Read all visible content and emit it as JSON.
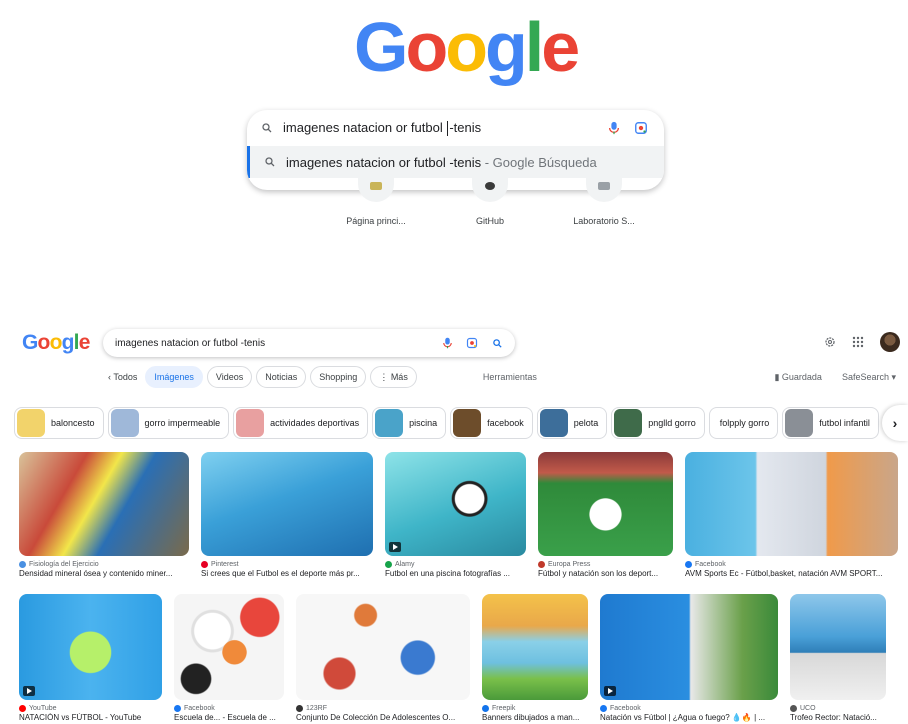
{
  "home": {
    "logo": [
      "G",
      "o",
      "o",
      "g",
      "l",
      "e"
    ],
    "query_before_caret": "imagenes natacion or futbol ",
    "query_after_caret": "-tenis",
    "suggestion_query": "imagenes natacion or futbol -tenis",
    "suggestion_suffix": " - Google Búsqueda",
    "shortcuts": [
      {
        "label": "Página princi..."
      },
      {
        "label": "GitHub"
      },
      {
        "label": "Laboratorio S..."
      }
    ]
  },
  "results": {
    "logo": [
      "G",
      "o",
      "o",
      "g",
      "l",
      "e"
    ],
    "query": "imagenes natacion or futbol -tenis",
    "nav": {
      "back": "‹ Todos",
      "tabs": [
        "Imágenes",
        "Videos",
        "Noticias",
        "Shopping",
        "⋮ Más"
      ],
      "active_tab": "Imágenes",
      "tools": "Herramientas",
      "saved": "Guardada",
      "safesearch": "SafeSearch ▾"
    },
    "filters": [
      {
        "label": "baloncesto",
        "color": "#f2d36b"
      },
      {
        "label": "gorro impermeable",
        "color": "#9fb8d9"
      },
      {
        "label": "actividades deportivas",
        "color": "#e8a0a0"
      },
      {
        "label": "piscina",
        "color": "#4aa3c9"
      },
      {
        "label": "facebook",
        "color": "#6d4d2b"
      },
      {
        "label": "pelota",
        "color": "#3d6e9a"
      },
      {
        "label": "pnglld gorro",
        "color": "#3f6b4a"
      },
      {
        "label": "folpply gorro",
        "color": ""
      },
      {
        "label": "futbol infantil",
        "color": "#8a8f96"
      }
    ],
    "row1": [
      {
        "source": "Fisiología del Ejercicio",
        "title": "Densidad mineral ósea y contenido miner...",
        "dot": "#4a90e2",
        "bg": "linear-gradient(120deg,#d9c39a 0%,#c94a3a 30%,#f2e64a 45%,#2a6fb5 60%,#7a6a4a 100%)"
      },
      {
        "source": "Pinterest",
        "title": "Si crees que el Futbol es el deporte más pr...",
        "dot": "#e60023",
        "bg": "linear-gradient(160deg,#7fd0f0 0%,#3aa0d8 45%,#1f6fb0 100%)"
      },
      {
        "source": "Alamy",
        "title": "Futbol en una piscina fotografías ...",
        "dot": "#17a34a",
        "bg": "radial-gradient(circle at 60% 45%,#ffffff 0 14%,#222 15% 17%,transparent 18%),linear-gradient(160deg,#8ee3e8 0%,#3fb5c8 55%,#2a8aa0 100%)"
      },
      {
        "source": "Europa Press",
        "title": "Fútbol y natación son los deport...",
        "dot": "#c0392b",
        "bg": "radial-gradient(circle at 50% 60%,#ffffff 0 17%,transparent 18%),linear-gradient(180deg,#8a3a3a 0%,#c25a4a 20%,#2f8a3a 30%,#3aa04a 100%)"
      },
      {
        "source": "Facebook",
        "title": "AVM Sports Ec - Fútbol,basket, natación AVM SPORT...",
        "dot": "#1877f2",
        "bg": "linear-gradient(90deg,#4ab0e0 0%,#6cc5ea 33%,#e4e8ef 34%,#cfd5de 66%,#f09a4a 67%,#c9a68a 100%)"
      }
    ],
    "row2": [
      {
        "source": "YouTube",
        "title": "NATACIÓN vs FÚTBOL - YouTube",
        "dot": "#ff0000",
        "bg": "radial-gradient(circle at 50% 55%,#b6f06a 0 22%,transparent 23%),linear-gradient(90deg,#2a9ae0 0%,#4bb3ef 50%,#30a0e6 100%)"
      },
      {
        "source": "Facebook",
        "title": "Escuela de... - Escuela de ...",
        "dot": "#1877f2",
        "bg": "radial-gradient(circle at 78% 22%,#e8463c 0 16%,transparent 17%),radial-gradient(circle at 55% 55%,#f08a3a 0 14%,transparent 15%),radial-gradient(circle at 20% 80%,#222 0 12%,transparent 13%),radial-gradient(circle at 35% 35%,#ffffff 0 18%,#e0e0e0 19% 21%,transparent 22%),#f5f5f5"
      },
      {
        "source": "123RF",
        "title": "Conjunto De Colección De Adolescentes O...",
        "dot": "#333333",
        "bg": "radial-gradient(circle at 25% 75%,#d04a3a 0 10%,transparent 11%),radial-gradient(circle at 70% 60%,#3a7ad0 0 12%,transparent 13%),radial-gradient(circle at 40% 20%,#e07a3a 0 8%,transparent 9%),#f7f7f7"
      },
      {
        "source": "Freepik",
        "title": "Banners dibujados a man...",
        "dot": "#1273eb",
        "bg": "linear-gradient(180deg,#f4c24a 0%,#e9a84a 30%,#8ad0e8 45%,#6ec0e0 65%,#7ac04a 80%,#4a9a3a 100%)"
      },
      {
        "source": "Facebook",
        "title": "Natación vs Fútbol | ¿Agua o fuego? 💧🔥 | ...",
        "dot": "#1877f2",
        "bg": "linear-gradient(90deg,#1f7ad0 0%,#2a8ee0 50%,#e8e8e8 51%,#6aa04a 80%,#3a8a3a 100%)"
      },
      {
        "source": "UCO",
        "title": "Trofeo Rector: Natació...",
        "dot": "#555555",
        "bg": "linear-gradient(180deg,#8ec7ea 0%,#4aa0d8 40%,#2f7fb8 55%,#d8d8d8 56%,#f0f0f0 100%)"
      }
    ]
  }
}
